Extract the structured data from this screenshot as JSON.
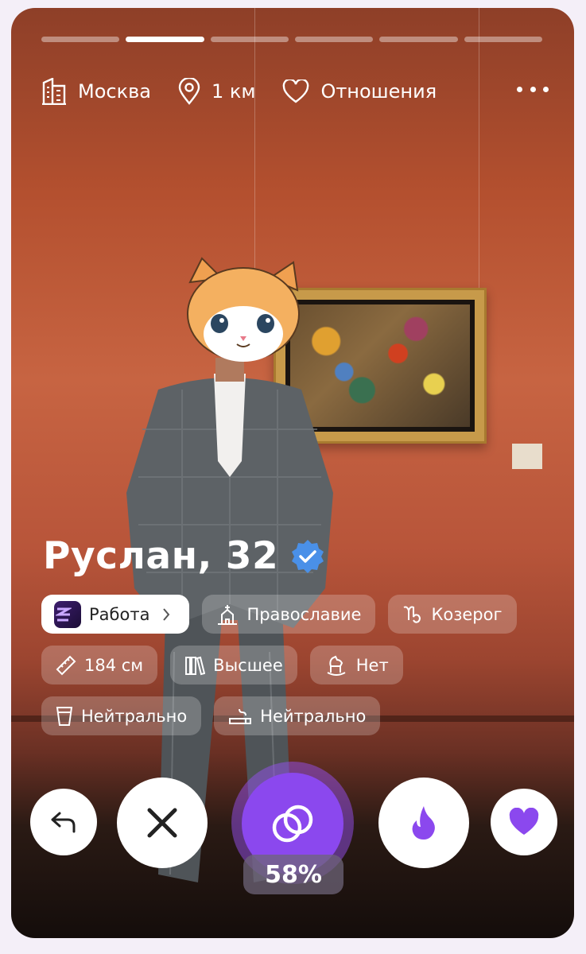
{
  "progress": {
    "segments": 6,
    "active_index": 1
  },
  "top_info": {
    "city": "Москва",
    "distance": "1 км",
    "goal": "Отношения"
  },
  "profile": {
    "name_age": "Руслан, 32",
    "verified": true
  },
  "chips": {
    "work": "Работа",
    "religion": "Православие",
    "zodiac": "Козерог",
    "height": "184 см",
    "education": "Высшее",
    "kids": "Нет",
    "alcohol": "Нейтрально",
    "smoking": "Нейтрально"
  },
  "match": {
    "percent": "58%"
  },
  "colors": {
    "accent": "#8b48ee",
    "verified": "#4a90e8",
    "work_logo": "#2a1450"
  },
  "icons": {
    "city": "building-icon",
    "distance": "location-pin-icon",
    "goal": "heart-outline-icon",
    "religion": "church-icon",
    "zodiac": "capricorn-icon",
    "height": "ruler-icon",
    "education": "books-icon",
    "kids": "rocking-horse-icon",
    "alcohol": "glass-icon",
    "smoking": "cigarette-icon",
    "undo": "undo-icon",
    "dislike": "close-icon",
    "match": "rings-icon",
    "superlike": "flame-icon",
    "like": "heart-icon"
  }
}
